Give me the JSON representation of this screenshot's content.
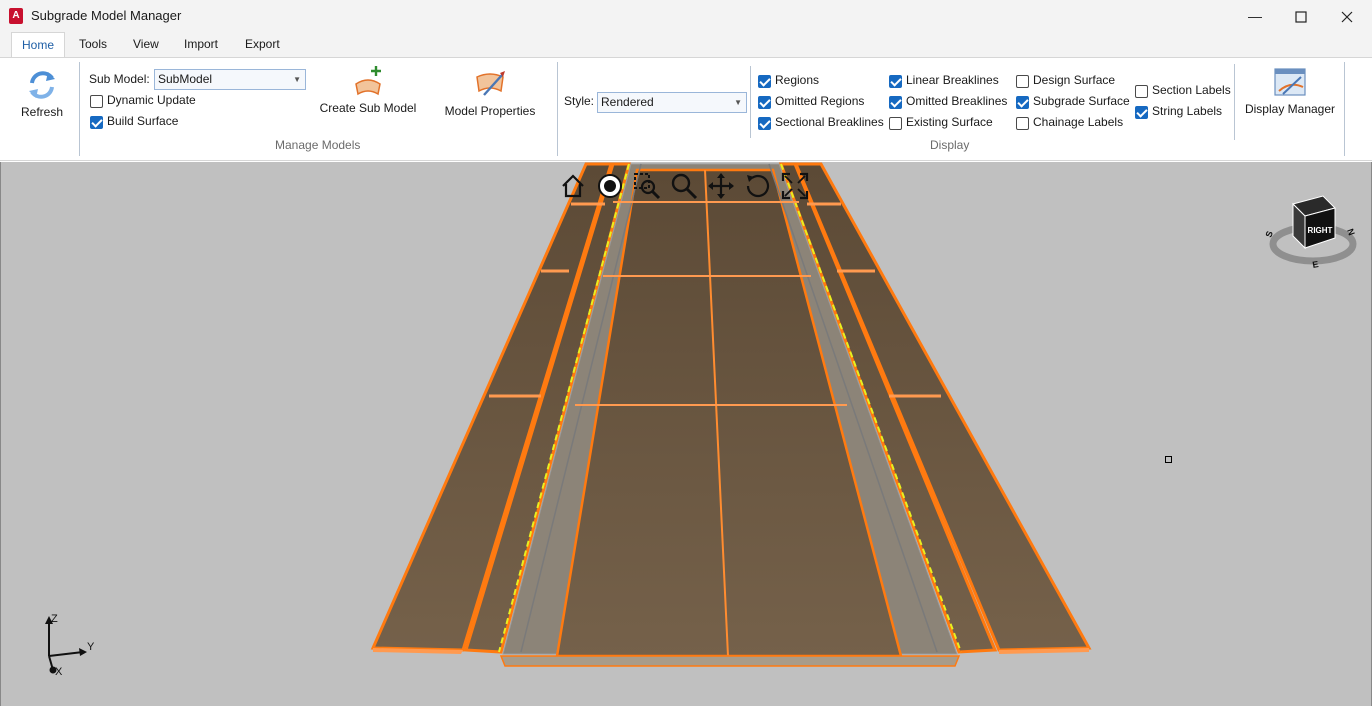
{
  "window": {
    "title": "Subgrade Model Manager",
    "icon_letter": "A",
    "controls": [
      "minimize-icon",
      "maximize-icon",
      "close-icon"
    ]
  },
  "tabs": [
    {
      "label": "Home",
      "active": true
    },
    {
      "label": "Tools",
      "active": false
    },
    {
      "label": "View",
      "active": false
    },
    {
      "label": "Import",
      "active": false
    },
    {
      "label": "Export",
      "active": false
    }
  ],
  "ribbon": {
    "refresh_label": "Refresh",
    "manage_models": {
      "group_label": "Manage Models",
      "sub_model_label": "Sub Model:",
      "sub_model_value": "SubModel",
      "dynamic_update": {
        "label": "Dynamic Update",
        "checked": false
      },
      "build_surface": {
        "label": "Build Surface",
        "checked": true
      },
      "create_sub_model_label": "Create Sub Model",
      "model_properties_label": "Model Properties"
    },
    "display": {
      "group_label": "Display",
      "style_label": "Style:",
      "style_value": "Rendered",
      "checkboxes": [
        {
          "label": "Regions",
          "checked": true
        },
        {
          "label": "Omitted Regions",
          "checked": true
        },
        {
          "label": "Sectional Breaklines",
          "checked": true
        },
        {
          "label": "Linear Breaklines",
          "checked": true
        },
        {
          "label": "Omitted Breaklines",
          "checked": true
        },
        {
          "label": "Existing Surface",
          "checked": false
        },
        {
          "label": "Design Surface",
          "checked": false
        },
        {
          "label": "Subgrade Surface",
          "checked": true
        },
        {
          "label": "Chainage Labels",
          "checked": false
        },
        {
          "label": "Section Labels",
          "checked": false
        },
        {
          "label": "String Labels",
          "checked": true
        }
      ],
      "display_manager_label": "Display Manager"
    }
  },
  "viewport": {
    "nav_tools": [
      "home-icon",
      "orbit-icon",
      "zoom-window-icon",
      "zoom-icon",
      "pan-icon",
      "rotate-icon",
      "zoom-extents-icon"
    ],
    "viewcube": {
      "face": "RIGHT",
      "compass": [
        "S",
        "N",
        "E"
      ]
    },
    "ucs": {
      "x": "X",
      "y": "Y",
      "z": "Z"
    },
    "colors": {
      "background": "#c0c0c0",
      "surface": "#6e5a44",
      "edge": "#ff7f1a",
      "centerline": "#e8f020"
    }
  }
}
